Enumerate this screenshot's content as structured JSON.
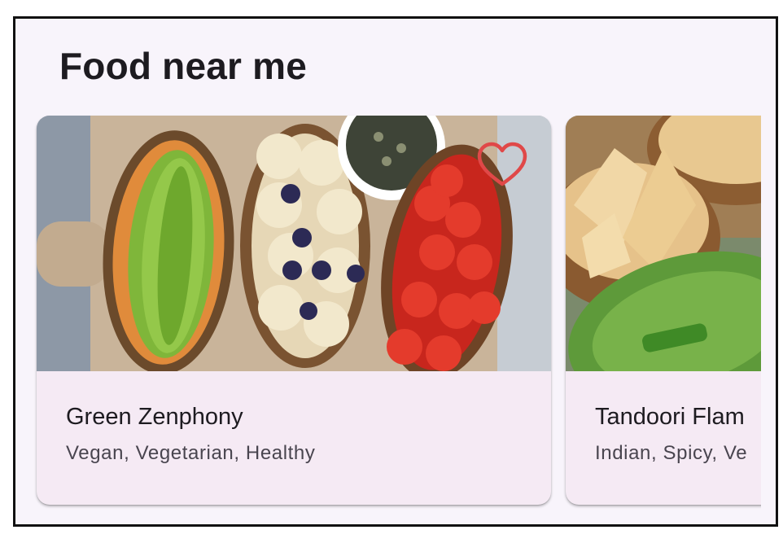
{
  "section": {
    "title": "Food near me"
  },
  "cards": [
    {
      "name": "Green Zenphony",
      "tags": "Vegan, Vegetarian, Healthy",
      "image": "avocado-banana-tomato-toasts-photo",
      "favorite_icon": "heart-outline-icon",
      "favorite_color": "#e04848"
    },
    {
      "name": "Tandoori Flam",
      "tags": "Indian, Spicy, Ve",
      "image": "naan-bread-basket-photo"
    }
  ],
  "colors": {
    "background": "#f8f4fb",
    "card_background": "#f5eaf4",
    "title_text": "#1d1b20",
    "subtitle_text": "#49454f",
    "frame_border": "#111111"
  }
}
